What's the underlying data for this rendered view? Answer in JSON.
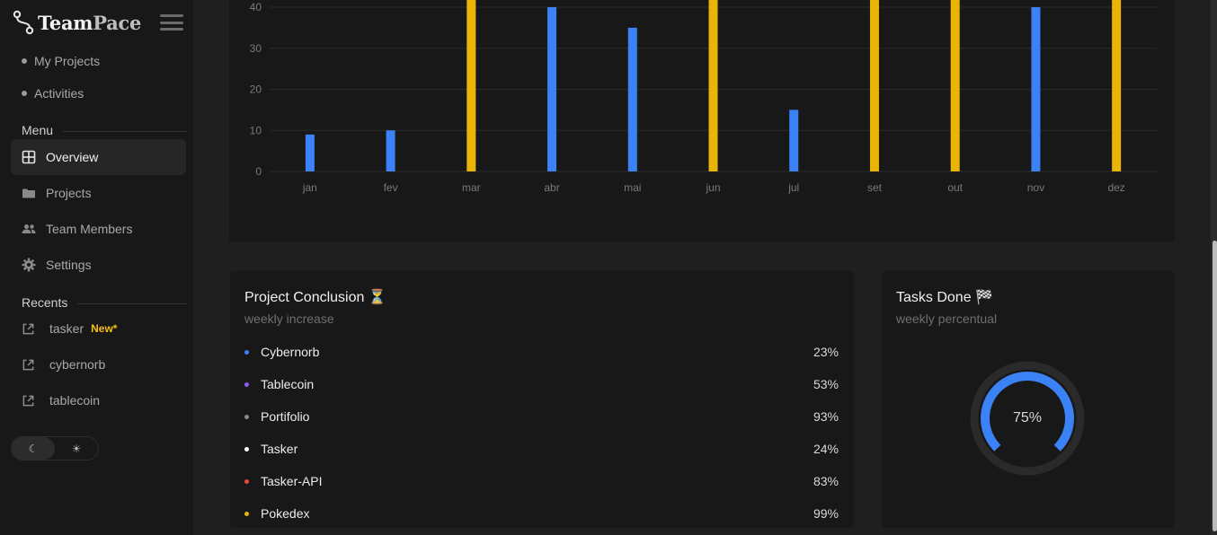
{
  "app": {
    "name_part1": "Team",
    "name_part2": "Pace"
  },
  "sidebar": {
    "sub_items": [
      {
        "label": "My Projects"
      },
      {
        "label": "Activities"
      }
    ],
    "menu_title": "Menu",
    "nav": [
      {
        "label": "Overview",
        "icon": "grid-icon",
        "active": true
      },
      {
        "label": "Projects",
        "icon": "folder-icon"
      },
      {
        "label": "Team Members",
        "icon": "users-icon"
      },
      {
        "label": "Settings",
        "icon": "gear-icon"
      }
    ],
    "recents_title": "Recents",
    "recents": [
      {
        "label": "tasker",
        "badge": "New*"
      },
      {
        "label": "cybernorb"
      },
      {
        "label": "tablecoin"
      }
    ],
    "theme": {
      "dark_icon": "moon-icon",
      "light_icon": "sun-icon",
      "dark_glyph": "☾",
      "light_glyph": "☀"
    }
  },
  "chart_data": {
    "type": "bar",
    "categories": [
      "jan",
      "fev",
      "mar",
      "abr",
      "mai",
      "jun",
      "jul",
      "set",
      "out",
      "nov",
      "dez"
    ],
    "values": [
      9,
      10,
      45,
      40,
      35,
      45,
      15,
      45,
      45,
      40,
      45
    ],
    "colors": [
      "#3b82f6",
      "#3b82f6",
      "#eab308",
      "#3b82f6",
      "#3b82f6",
      "#eab308",
      "#3b82f6",
      "#eab308",
      "#eab308",
      "#3b82f6",
      "#eab308"
    ],
    "y_ticks": [
      "0",
      "10",
      "20",
      "30",
      "40"
    ],
    "ylim": [
      0,
      40
    ],
    "grid": true
  },
  "project_card": {
    "title": "Project Conclusion ⏳",
    "subtitle": "weekly increase",
    "projects": [
      {
        "name": "Cybernorb",
        "pct": "23%",
        "color": "#3b82f6"
      },
      {
        "name": "Tablecoin",
        "pct": "53%",
        "color": "#8b5cf6"
      },
      {
        "name": "Portifolio",
        "pct": "93%",
        "color": "#8a8a8a"
      },
      {
        "name": "Tasker",
        "pct": "24%",
        "color": "#ffffff"
      },
      {
        "name": "Tasker-API",
        "pct": "83%",
        "color": "#ef4444"
      },
      {
        "name": "Pokedex",
        "pct": "99%",
        "color": "#eab308"
      }
    ]
  },
  "tasks_card": {
    "title": "Tasks Done 🏁",
    "subtitle": "weekly percentual",
    "value_label": "75%",
    "value": 0.75,
    "accent": "#3b82f6"
  }
}
